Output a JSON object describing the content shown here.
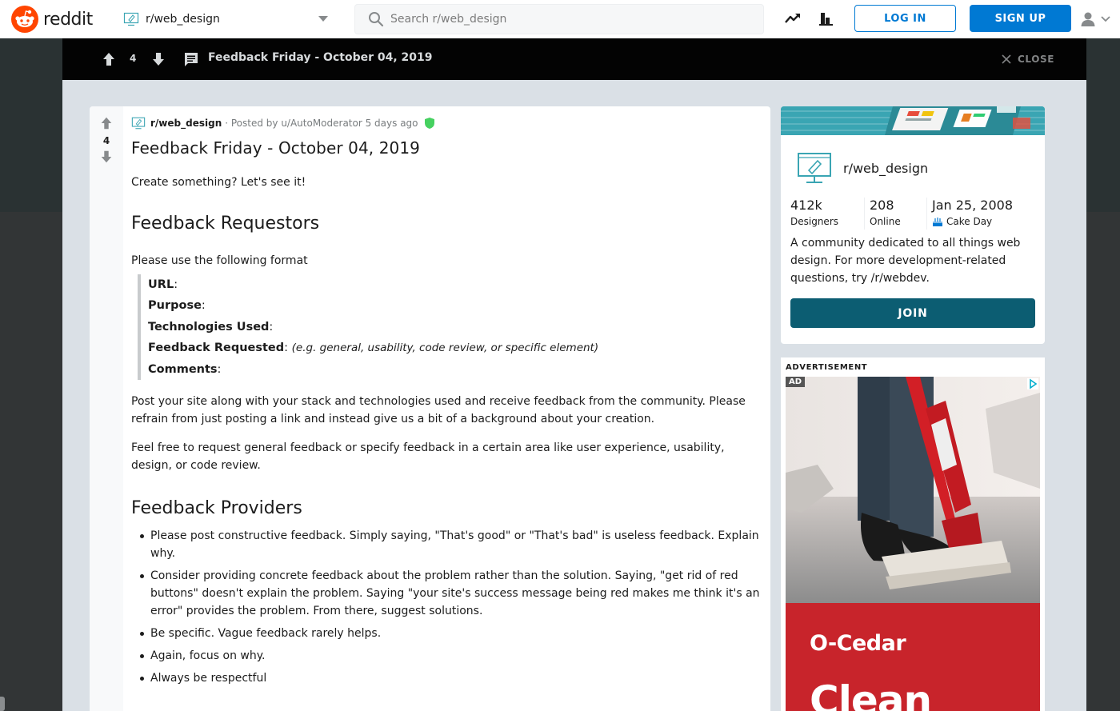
{
  "header": {
    "logo_text": "reddit",
    "subreddit_selector": "r/web_design",
    "search_placeholder": "Search r/web_design",
    "login_label": "LOG IN",
    "signup_label": "SIGN UP",
    "icons": [
      "trending-icon",
      "stats-icon",
      "user-icon"
    ]
  },
  "postbar": {
    "score": "4",
    "title": "Feedback Friday - October 04, 2019",
    "close_label": "CLOSE"
  },
  "post": {
    "score": "4",
    "subreddit": "r/web_design",
    "meta": "· Posted by u/AutoModerator 5 days ago",
    "title": "Feedback Friday - October 04, 2019",
    "intro": "Create something? Let's see it!",
    "section1_heading": "Feedback Requestors",
    "format_intro": "Please use the following format",
    "format_fields": [
      {
        "label": "URL",
        "hint": ""
      },
      {
        "label": "Purpose",
        "hint": ""
      },
      {
        "label": "Technologies Used",
        "hint": ""
      },
      {
        "label": "Feedback Requested",
        "hint": "(e.g. general, usability, code review, or specific element)"
      },
      {
        "label": "Comments",
        "hint": ""
      }
    ],
    "para1": "Post your site along with your stack and technologies used and receive feedback from the community. Please refrain from just posting a link and instead give us a bit of a background about your creation.",
    "para2": "Feel free to request general feedback or specify feedback in a certain area like user experience, usability, design, or code review.",
    "section2_heading": "Feedback Providers",
    "provider_rules": [
      "Please post constructive feedback. Simply saying, \"That's good\" or \"That's bad\" is useless feedback. Explain why.",
      "Consider providing concrete feedback about the problem rather than the solution. Saying, \"get rid of red buttons\" doesn't explain the problem. Saying \"your site's success message being red makes me think it's an error\" provides the problem. From there, suggest solutions.",
      "Be specific. Vague feedback rarely helps.",
      "Again, focus on why.",
      "Always be respectful"
    ]
  },
  "about": {
    "name": "r/web_design",
    "stats": [
      {
        "value": "412k",
        "label": "Designers"
      },
      {
        "value": "208",
        "label": "Online"
      },
      {
        "value": "Jan 25, 2008",
        "label": "Cake Day"
      }
    ],
    "description": "A community dedicated to all things web design. For more development-related questions, try /r/webdev.",
    "join_label": "JOIN"
  },
  "ad": {
    "label": "ADVERTISEMENT",
    "badge": "AD",
    "brand": "O-Cedar",
    "headline": "Clean"
  },
  "colors": {
    "accent": "#0079d3",
    "join": "#0c5d72",
    "reddit_orange": "#ff4500",
    "ad_red": "#c8242b"
  }
}
